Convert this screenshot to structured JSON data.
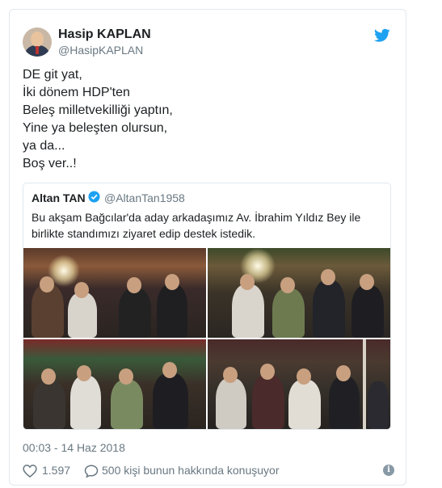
{
  "author": {
    "name": "Hasip KAPLAN",
    "handle": "@HasipKAPLAN",
    "avatar_icon": "profile-photo"
  },
  "brand_icon": "twitter-bird-icon",
  "brand_color": "#1da1f2",
  "tweet": {
    "lines": [
      "DE git yat,",
      "İki dönem HDP'ten",
      "Beleş milletvekilliği yaptın,",
      "Yine ya beleşten olursun,",
      "ya da...",
      "Boş ver..!"
    ]
  },
  "quoted_tweet": {
    "name": "Altan TAN",
    "verified_icon": "verified-badge-icon",
    "handle": "@AltanTan1958",
    "text": "Bu akşam Bağcılar'da aday arkadaşımız Av. İbrahim Yıldız Bey ile birlikte standımızı ziyaret edip destek istedik.",
    "photo_count": 4
  },
  "meta": {
    "timestamp": "00:03 - 14 Haz 2018"
  },
  "actions": {
    "like_icon": "heart-icon",
    "like_count": "1.597",
    "reply_icon": "speech-bubble-icon",
    "conversation_text": "500 kişi bunun hakkında konuşuyor",
    "info_icon": "info-icon",
    "info_glyph": "i"
  }
}
